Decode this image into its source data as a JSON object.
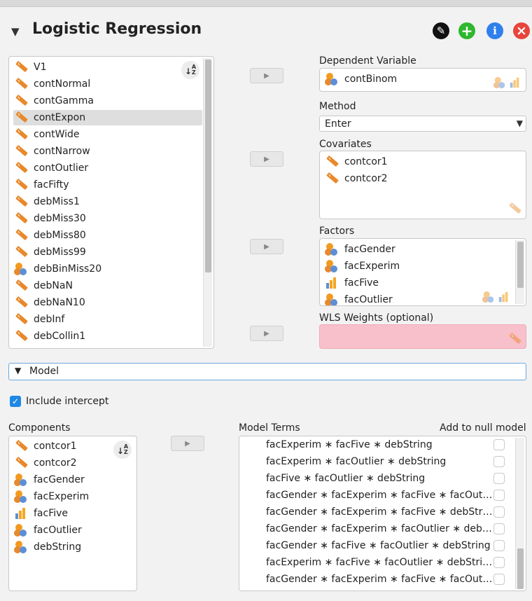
{
  "header": {
    "title": "Logistic Regression",
    "buttons": [
      {
        "name": "edit",
        "color": "#111111",
        "glyph": "✎"
      },
      {
        "name": "add",
        "color": "#2eb82e",
        "glyph": "+"
      },
      {
        "name": "info",
        "color": "#2f80ed",
        "glyph": "i"
      },
      {
        "name": "close",
        "color": "#e8453c",
        "glyph": "×"
      }
    ]
  },
  "sort_label": "↓A Z",
  "variables": [
    {
      "label": "V1",
      "type": "scale"
    },
    {
      "label": "contNormal",
      "type": "scale"
    },
    {
      "label": "contGamma",
      "type": "scale"
    },
    {
      "label": "contExpon",
      "type": "scale",
      "selected": true
    },
    {
      "label": "contWide",
      "type": "scale"
    },
    {
      "label": "contNarrow",
      "type": "scale"
    },
    {
      "label": "contOutlier",
      "type": "scale"
    },
    {
      "label": "facFifty",
      "type": "scale"
    },
    {
      "label": "debMiss1",
      "type": "scale"
    },
    {
      "label": "debMiss30",
      "type": "scale"
    },
    {
      "label": "debMiss80",
      "type": "scale"
    },
    {
      "label": "debMiss99",
      "type": "scale"
    },
    {
      "label": "debBinMiss20",
      "type": "nominal"
    },
    {
      "label": "debNaN",
      "type": "scale"
    },
    {
      "label": "debNaN10",
      "type": "scale"
    },
    {
      "label": "debInf",
      "type": "scale"
    },
    {
      "label": "debCollin1",
      "type": "scale"
    }
  ],
  "dependent": {
    "label": "Dependent Variable",
    "value": "contBinom"
  },
  "method": {
    "label": "Method",
    "value": "Enter"
  },
  "covariates": {
    "label": "Covariates",
    "items": [
      "contcor1",
      "contcor2"
    ]
  },
  "factors": {
    "label": "Factors",
    "items": [
      {
        "label": "facGender",
        "type": "nominal"
      },
      {
        "label": "facExperim",
        "type": "nominal"
      },
      {
        "label": "facFive",
        "type": "ordinal"
      },
      {
        "label": "facOutlier",
        "type": "nominal"
      }
    ]
  },
  "wls": {
    "label": "WLS Weights (optional)"
  },
  "model": {
    "section_label": "Model",
    "include_intercept": "Include intercept",
    "components_label": "Components",
    "model_terms_label": "Model Terms",
    "add_null_label": "Add to null model",
    "components": [
      {
        "label": "contcor1",
        "type": "scale"
      },
      {
        "label": "contcor2",
        "type": "scale"
      },
      {
        "label": "facGender",
        "type": "nominal"
      },
      {
        "label": "facExperim",
        "type": "nominal"
      },
      {
        "label": "facFive",
        "type": "ordinal"
      },
      {
        "label": "facOutlier",
        "type": "nominal"
      },
      {
        "label": "debString",
        "type": "nominal"
      }
    ],
    "terms": [
      "facExperim ∗ facFive ∗ debString",
      "facExperim ∗ facOutlier ∗ debString",
      "facFive ∗ facOutlier ∗ debString",
      "facGender ∗ facExperim ∗ facFive ∗ facOut…",
      "facGender ∗ facExperim ∗ facFive ∗ debStr…",
      "facGender ∗ facExperim ∗ facOutlier ∗ deb…",
      "facGender ∗ facFive ∗ facOutlier ∗ debString",
      "facExperim ∗ facFive ∗ facOutlier ∗ debStri…",
      "facGender ∗ facExperim ∗ facFive ∗ facOut…"
    ]
  },
  "colors": {
    "ruler": "#e8892b",
    "nominal_a": "#f29a1f",
    "nominal_b": "#5c8fd6",
    "ordinal": "#f5a623",
    "accent": "#1e88e5",
    "wls_bg": "#f8c0cb"
  }
}
